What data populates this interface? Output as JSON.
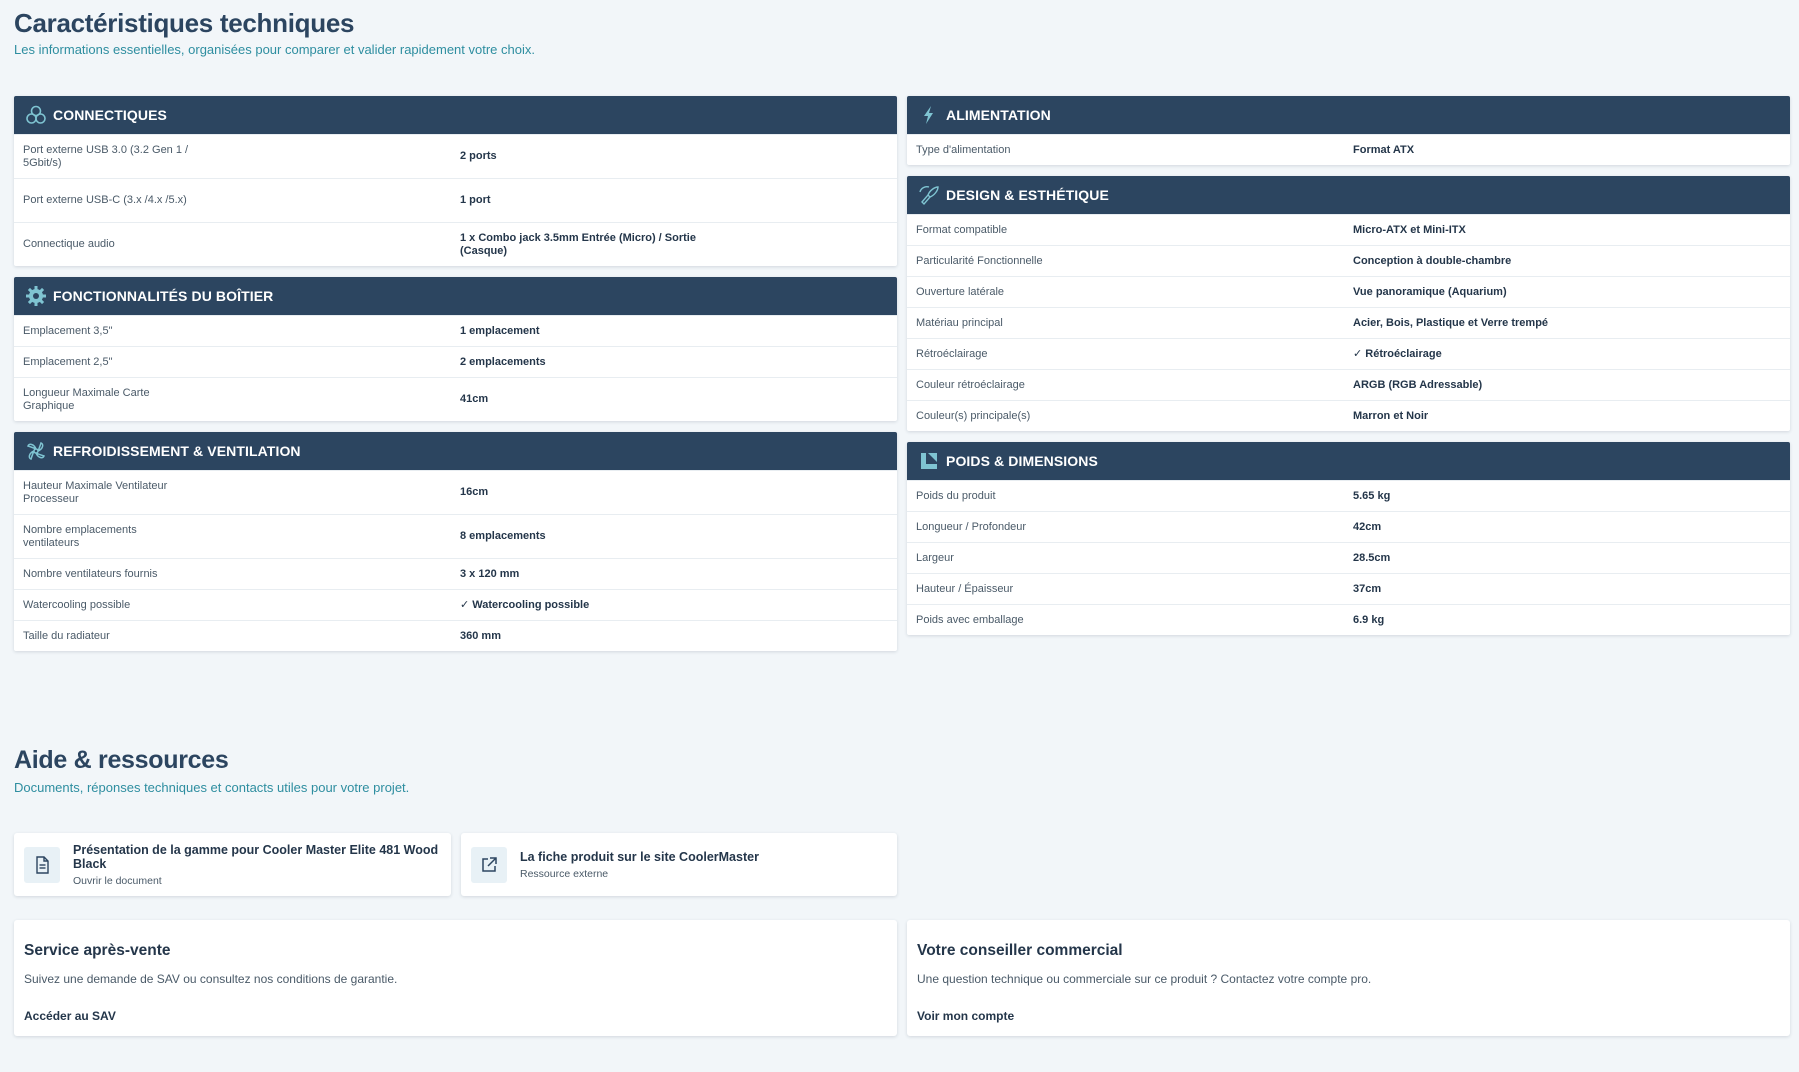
{
  "specs": {
    "title": "Caractéristiques techniques",
    "subtitle": "Les informations essentielles, organisées pour comparer et valider rapidement votre choix.",
    "connectiques": {
      "title": "CONNECTIQUES",
      "icon": "connections-icon",
      "rows": [
        {
          "label": "Port externe USB 3.0 (3.2 Gen 1 / 5Gbit/s)",
          "value": "2 ports"
        },
        {
          "label": "Port externe USB-C (3.x /4.x /5.x)",
          "value": "1 port"
        },
        {
          "label": "Connectique audio",
          "value": "1 x Combo jack 3.5mm Entrée (Micro) / Sortie (Casque)"
        }
      ]
    },
    "fonctionnalites": {
      "title": "FONCTIONNALITÉS DU BOÎTIER",
      "icon": "gear-icon",
      "rows": [
        {
          "label": "Emplacement 3,5\"",
          "value": "1 emplacement"
        },
        {
          "label": "Emplacement 2,5\"",
          "value": "2 emplacements"
        },
        {
          "label": "Longueur Maximale Carte Graphique",
          "value": "41cm"
        }
      ]
    },
    "refroidissement": {
      "title": "REFROIDISSEMENT & VENTILATION",
      "icon": "fan-icon",
      "rows": [
        {
          "label": "Hauteur Maximale Ventilateur Processeur",
          "value": "16cm"
        },
        {
          "label": "Nombre emplacements ventilateurs",
          "value": "8 emplacements"
        },
        {
          "label": "Nombre ventilateurs fournis",
          "value": "3 x 120 mm"
        },
        {
          "label": "Watercooling possible",
          "value": "✓ Watercooling possible"
        },
        {
          "label": "Taille du radiateur",
          "value": "360 mm"
        }
      ]
    },
    "alimentation": {
      "title": "ALIMENTATION",
      "icon": "lightning-icon",
      "rows": [
        {
          "label": "Type d'alimentation",
          "value": "Format ATX"
        }
      ]
    },
    "design": {
      "title": "DESIGN & ESTHÉTIQUE",
      "icon": "palette-icon",
      "rows": [
        {
          "label": "Format compatible",
          "value": "Micro-ATX et Mini-ITX"
        },
        {
          "label": "Particularité Fonctionnelle",
          "value": "Conception à double-chambre"
        },
        {
          "label": "Ouverture latérale",
          "value": "Vue panoramique (Aquarium)"
        },
        {
          "label": "Matériau principal",
          "value": "Acier, Bois, Plastique et Verre trempé"
        },
        {
          "label": "Rétroéclairage",
          "value": "✓ Rétroéclairage"
        },
        {
          "label": "Couleur rétroéclairage",
          "value": "ARGB (RGB Adressable)"
        },
        {
          "label": "Couleur(s) principale(s)",
          "value": "Marron et Noir"
        }
      ]
    },
    "poids": {
      "title": "POIDS & DIMENSIONS",
      "icon": "ruler-icon",
      "rows": [
        {
          "label": "Poids du produit",
          "value": "5.65 kg"
        },
        {
          "label": "Longueur / Profondeur",
          "value": "42cm"
        },
        {
          "label": "Largeur",
          "value": "28.5cm"
        },
        {
          "label": "Hauteur / Épaisseur",
          "value": "37cm"
        },
        {
          "label": "Poids avec emballage",
          "value": "6.9 kg"
        }
      ]
    }
  },
  "help": {
    "title": "Aide & ressources",
    "subtitle": "Documents, réponses techniques et contacts utiles pour votre projet.",
    "resources": [
      {
        "title": "Présentation de la gamme pour Cooler Master Elite 481 Wood Black",
        "sub": "Ouvrir le document",
        "icon": "document-icon"
      },
      {
        "title": "La fiche produit sur le site CoolerMaster",
        "sub": "Ressource externe",
        "icon": "external-link-icon"
      }
    ],
    "sav": {
      "title": "Service après-vente",
      "text": "Suivez une demande de SAV ou consultez nos conditions de garantie.",
      "link": "Accéder au SAV"
    },
    "conseiller": {
      "title": "Votre conseiller commercial",
      "text": "Une question technique ou commerciale sur ce produit ? Contactez votre compte pro.",
      "link": "Voir mon compte"
    }
  },
  "colors": {
    "header": "#2c4560",
    "accent": "#2e8ea0",
    "background": "#f2f6f9"
  }
}
